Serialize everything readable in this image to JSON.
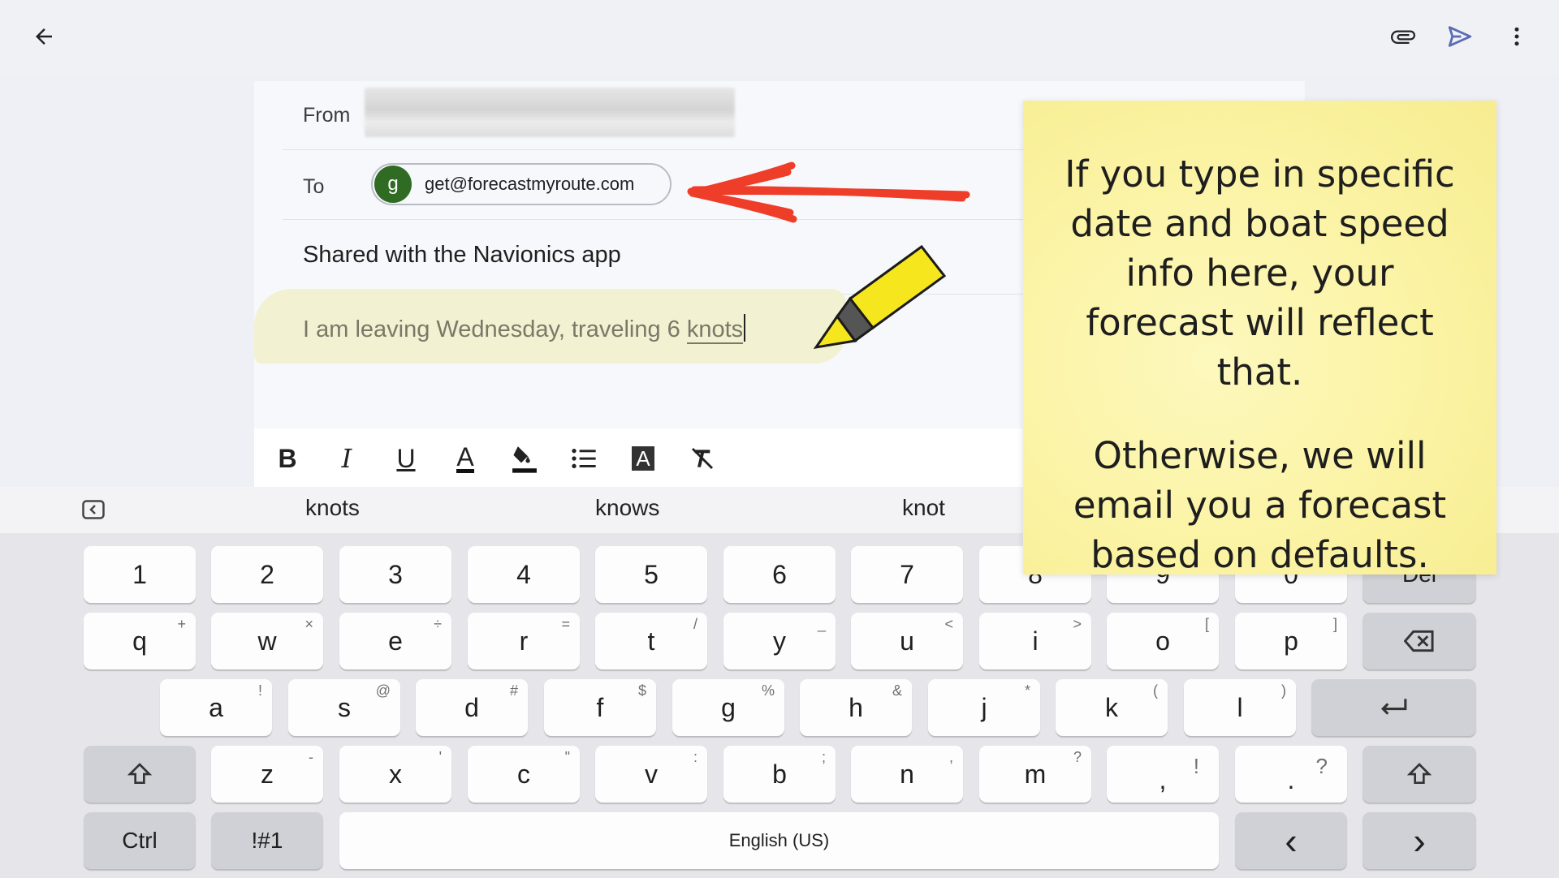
{
  "header": {
    "back_icon": "arrow-left-icon",
    "attach_icon": "paperclip-icon",
    "send_icon": "send-icon",
    "more_icon": "more-vert-icon",
    "send_color": "#5b6bb5"
  },
  "compose": {
    "from_label": "From",
    "to_label": "To",
    "recipient": {
      "initial": "g",
      "email": "get@forecastmyroute.com",
      "avatar_color": "#2f6b23"
    },
    "subject": "Shared with the Navionics app",
    "body_prefix": "I am leaving Wednesday, traveling 6 ",
    "body_last_word": "knots"
  },
  "format_toolbar": [
    {
      "name": "bold-button",
      "label": "B",
      "icon": "bold-icon"
    },
    {
      "name": "italic-button",
      "label": "I",
      "icon": "italic-icon"
    },
    {
      "name": "underline-button",
      "label": "U",
      "icon": "underline-icon"
    },
    {
      "name": "text-color-button",
      "label": "A",
      "icon": "text-color-icon"
    },
    {
      "name": "fill-color-button",
      "label": "",
      "icon": "fill-color-icon"
    },
    {
      "name": "bullet-list-button",
      "label": "",
      "icon": "bullet-list-icon"
    },
    {
      "name": "text-background-button",
      "label": "A",
      "icon": "text-background-icon"
    },
    {
      "name": "clear-format-button",
      "label": "",
      "icon": "clear-format-icon"
    }
  ],
  "suggestions": [
    "knots",
    "knows",
    "knot"
  ],
  "keyboard": {
    "numbers": [
      "1",
      "2",
      "3",
      "4",
      "5",
      "6",
      "7",
      "8",
      "9",
      "0"
    ],
    "del_label": "Del",
    "row_q": [
      {
        "k": "q",
        "h": "+"
      },
      {
        "k": "w",
        "h": "×"
      },
      {
        "k": "e",
        "h": "÷"
      },
      {
        "k": "r",
        "h": "="
      },
      {
        "k": "t",
        "h": "/"
      },
      {
        "k": "y",
        "h": "_"
      },
      {
        "k": "u",
        "h": "<"
      },
      {
        "k": "i",
        "h": ">"
      },
      {
        "k": "o",
        "h": "["
      },
      {
        "k": "p",
        "h": "]"
      }
    ],
    "row_a": [
      {
        "k": "a",
        "h": "!"
      },
      {
        "k": "s",
        "h": "@"
      },
      {
        "k": "d",
        "h": "#"
      },
      {
        "k": "f",
        "h": "$"
      },
      {
        "k": "g",
        "h": "%"
      },
      {
        "k": "h",
        "h": "&"
      },
      {
        "k": "j",
        "h": "*"
      },
      {
        "k": "k",
        "h": "("
      },
      {
        "k": "l",
        "h": ")"
      }
    ],
    "row_z": [
      {
        "k": "z",
        "h": "-"
      },
      {
        "k": "x",
        "h": "'"
      },
      {
        "k": "c",
        "h": "\""
      },
      {
        "k": "v",
        "h": ":"
      },
      {
        "k": "b",
        "h": ";"
      },
      {
        "k": "n",
        "h": ","
      },
      {
        "k": "m",
        "h": "?"
      },
      {
        "k": ",",
        "h": "!"
      },
      {
        "k": ".",
        "h": "?"
      }
    ],
    "ctrl_label": "Ctrl",
    "symbols_label": "!#1",
    "space_label": "English (US)",
    "left_arrow": "‹",
    "right_arrow": "›"
  },
  "note": {
    "paragraph1": "If you type in specific date and boat speed info here, your forecast will reflect that.",
    "paragraph2": "Otherwise, we will email you a forecast based on defaults."
  }
}
